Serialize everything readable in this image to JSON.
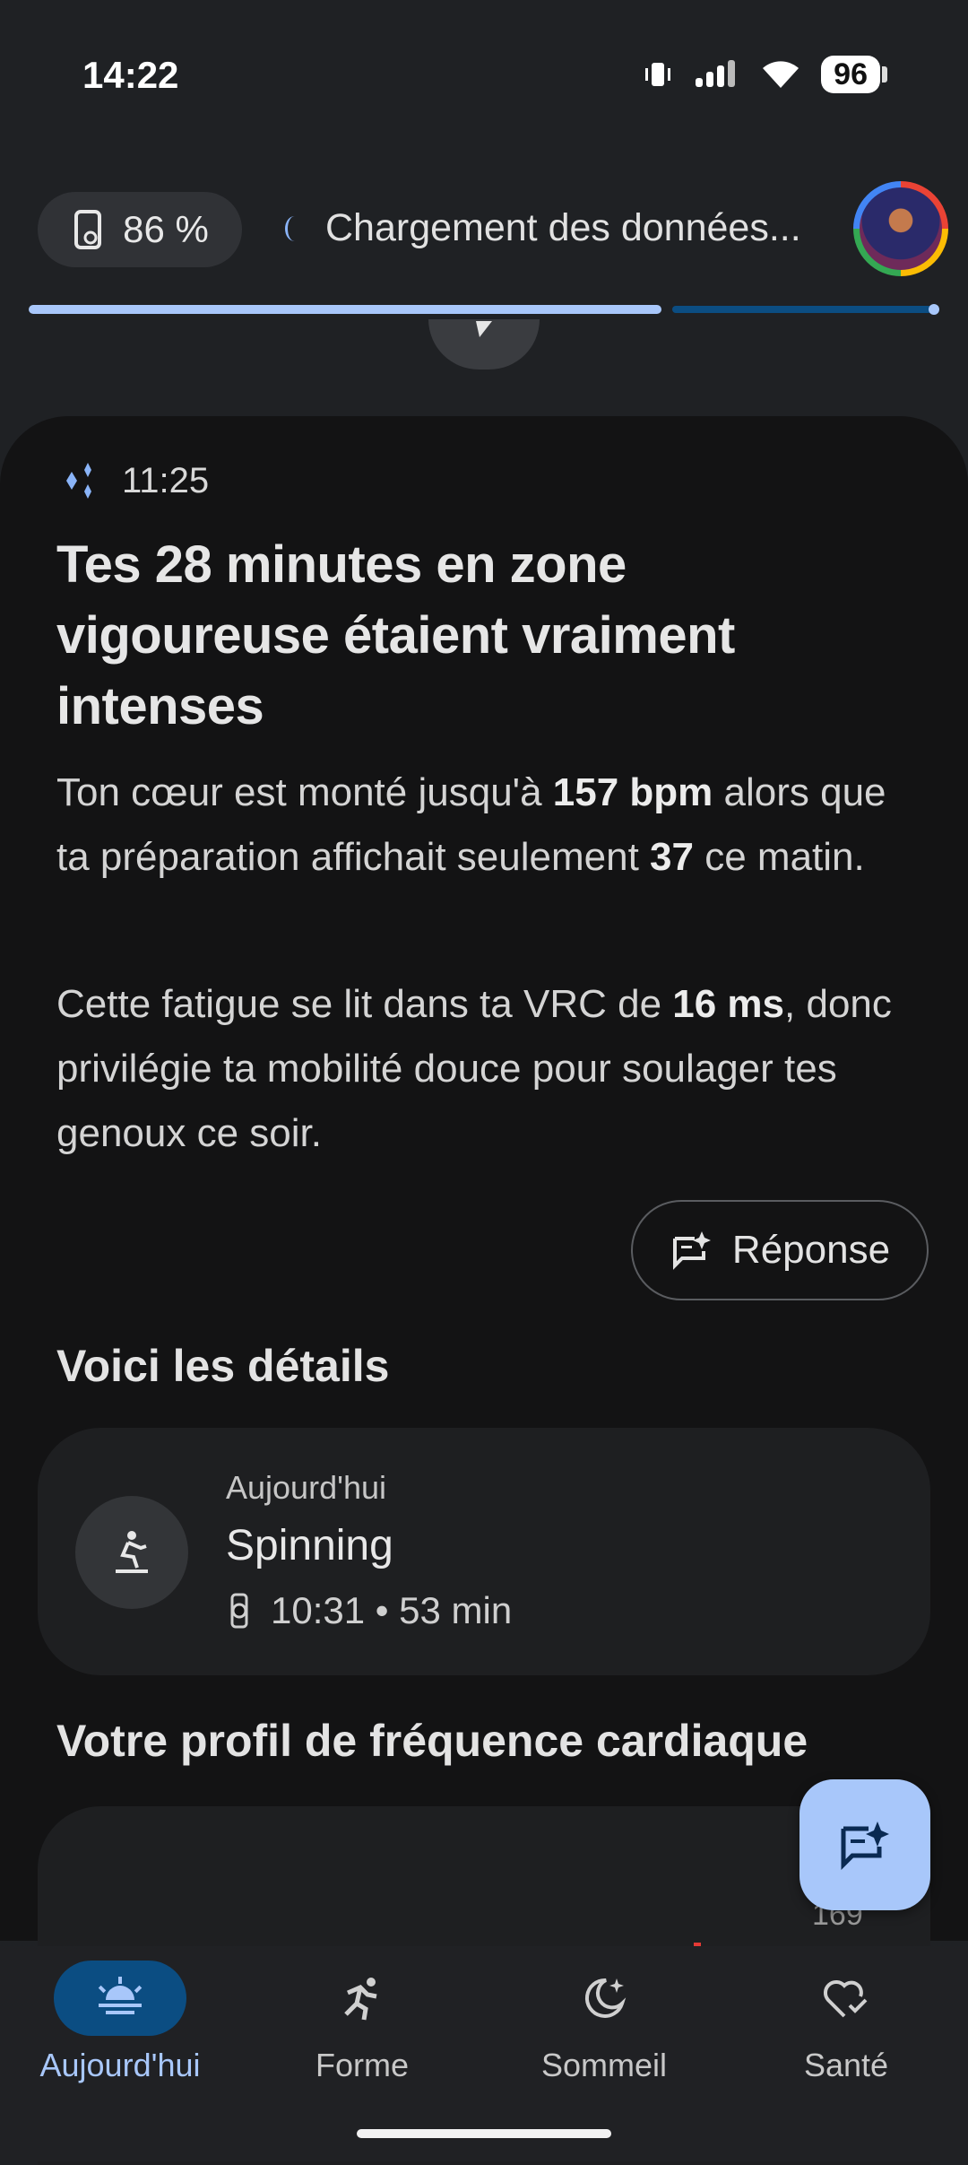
{
  "status_bar": {
    "time": "14:22",
    "battery": "96"
  },
  "top_bar": {
    "watch_battery": "86 %",
    "loading_text": "Chargement des données..."
  },
  "insight": {
    "time": "11:25",
    "headline": "Tes 28 minutes en zone vigoureuse étaient vraiment intenses",
    "p1_a": "Ton cœur est monté jusqu'à ",
    "p1_b": "157 bpm",
    "p1_c": " alors que ta préparation affichait seulement ",
    "p1_d": "37",
    "p1_e": " ce matin.",
    "p2_a": "Cette fatigue se lit dans ta VRC de ",
    "p2_b": "16 ms",
    "p2_c": ", donc privilégie ta mobilité douce pour soulager tes genoux ce soir.",
    "reply_label": "Réponse"
  },
  "details": {
    "title": "Voici les détails",
    "activity": {
      "date": "Aujourd'hui",
      "name": "Spinning",
      "meta": "10:31 • 53 min"
    }
  },
  "heart_profile": {
    "title": "Votre profil de fréquence cardiaque",
    "tick": "169"
  },
  "nav": [
    {
      "label": "Aujourd'hui",
      "active": true
    },
    {
      "label": "Forme",
      "active": false
    },
    {
      "label": "Sommeil",
      "active": false
    },
    {
      "label": "Santé",
      "active": false
    }
  ],
  "colors": {
    "accent": "#a8c7fa",
    "active_pill": "#0b4d82",
    "card_bg": "#131314"
  }
}
